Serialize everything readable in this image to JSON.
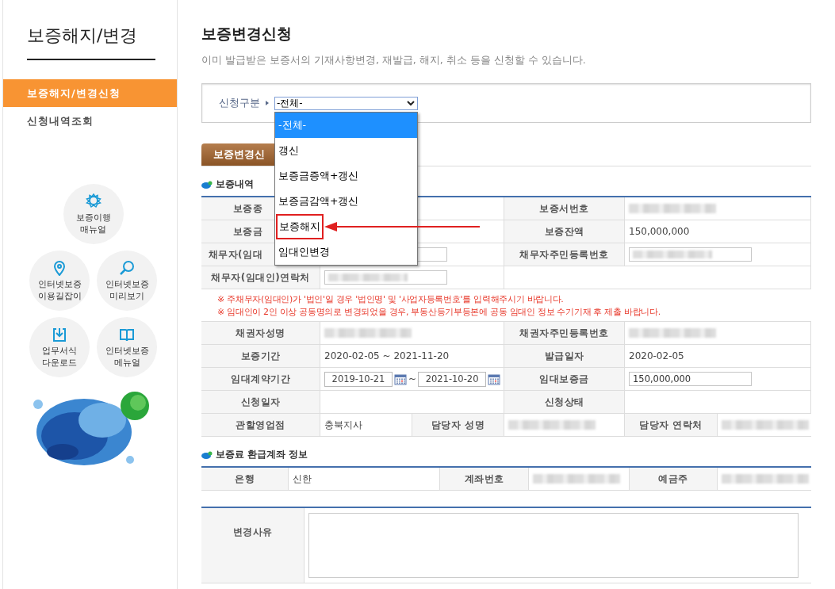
{
  "sidebar": {
    "title": "보증해지/변경",
    "menu": [
      {
        "label": "보증해지/변경신청",
        "selected": true
      },
      {
        "label": "신청내역조회",
        "selected": false
      }
    ],
    "shortcuts": [
      {
        "label": "보증이행\n매뉴얼"
      },
      {
        "label": "인터넷보증\n이용길잡이"
      },
      {
        "label": "인터넷보증\n미리보기"
      },
      {
        "label": "업무서식\n다운로드"
      },
      {
        "label": "인터넷보증\n메뉴얼"
      }
    ]
  },
  "page": {
    "title": "보증변경신청",
    "subtitle": "이미 발급받은 보증서의 기재사항변경, 재발급, 해지, 취소 등을 신청할 수 있습니다."
  },
  "filter": {
    "label": "신청구분",
    "select": {
      "value": "-전체-",
      "expanded": true,
      "options": [
        {
          "label": "-전체-",
          "selected": true,
          "highlighted": false
        },
        {
          "label": "갱신",
          "selected": false,
          "highlighted": false
        },
        {
          "label": "보증금증액+갱신",
          "selected": false,
          "highlighted": false
        },
        {
          "label": "보증금감액+갱신",
          "selected": false,
          "highlighted": false
        },
        {
          "label": "보증해지",
          "selected": false,
          "highlighted": true
        },
        {
          "label": "임대인변경",
          "selected": false,
          "highlighted": false
        }
      ]
    }
  },
  "tab": {
    "label": "보증변경신",
    "selected": true
  },
  "sections": [
    {
      "title": "보증내역",
      "rows": [
        [
          {
            "kind": "label",
            "text": "보증종",
            "cut": true
          },
          {
            "kind": "empty"
          },
          {
            "kind": "label",
            "text": "보증서번호"
          },
          {
            "kind": "blur"
          }
        ],
        [
          {
            "kind": "label",
            "text": "보증금",
            "cut": true
          },
          {
            "kind": "empty"
          },
          {
            "kind": "label",
            "text": "보증잔액"
          },
          {
            "kind": "text",
            "text": "150,000,000"
          }
        ],
        [
          {
            "kind": "label",
            "text": "채무자(임대",
            "cut": true
          },
          {
            "kind": "blur-input"
          },
          {
            "kind": "label",
            "text": "채무자주민등록번호"
          },
          {
            "kind": "blur-input"
          }
        ],
        [
          {
            "kind": "label",
            "text": "채무자(임대인)연락처"
          },
          {
            "kind": "blur-input"
          }
        ],
        [
          {
            "kind": "note",
            "lines": [
              "※ 주채무자(임대인)가 '법인'일 경우 '법인명' 및 '사업자등록번호'를 입력해주시기 바랍니다.",
              "※ 임대인이 2인 이상 공동명의로 변경되었을 경우, 부동산등기부등본에 공동 임대인 정보 수기기재 후 제출 바랍니다."
            ]
          }
        ],
        [
          {
            "kind": "label",
            "text": "채권자성명"
          },
          {
            "kind": "blur"
          },
          {
            "kind": "label",
            "text": "채권자주민등록번호"
          },
          {
            "kind": "blur"
          }
        ],
        [
          {
            "kind": "label",
            "text": "보증기간"
          },
          {
            "kind": "text",
            "text": "2020-02-05   ~  2021-11-20"
          },
          {
            "kind": "label",
            "text": "발급일자"
          },
          {
            "kind": "text",
            "text": "2020-02-05"
          }
        ],
        [
          {
            "kind": "label",
            "text": "임대계약기간"
          },
          {
            "kind": "dates",
            "from": "2019-10-21",
            "separator": "~",
            "to": "2021-10-20"
          },
          {
            "kind": "label",
            "text": "임대보증금"
          },
          {
            "kind": "input",
            "text": "150,000,000"
          }
        ],
        [
          {
            "kind": "label",
            "text": "신청일자"
          },
          {
            "kind": "empty"
          },
          {
            "kind": "label",
            "text": "신청상태"
          },
          {
            "kind": "empty"
          }
        ],
        [
          {
            "kind": "label",
            "text": "관할영업점"
          },
          {
            "kind": "text",
            "text": "충북지사"
          },
          {
            "kind": "label",
            "text": "담당자 성명"
          },
          {
            "kind": "blur"
          },
          {
            "kind": "label",
            "text": "담당자 연락처"
          },
          {
            "kind": "blur"
          }
        ]
      ]
    },
    {
      "title": "보증료 환급계좌 정보",
      "rows": [
        [
          {
            "kind": "label",
            "text": "은행"
          },
          {
            "kind": "text",
            "text": "신한"
          },
          {
            "kind": "label",
            "text": "계좌번호"
          },
          {
            "kind": "blur"
          },
          {
            "kind": "label",
            "text": "예금주"
          },
          {
            "kind": "blur"
          }
        ]
      ]
    },
    {
      "rows": [
        [
          {
            "kind": "label",
            "text": "변경사유",
            "top": true
          },
          {
            "kind": "textarea"
          }
        ]
      ]
    }
  ]
}
